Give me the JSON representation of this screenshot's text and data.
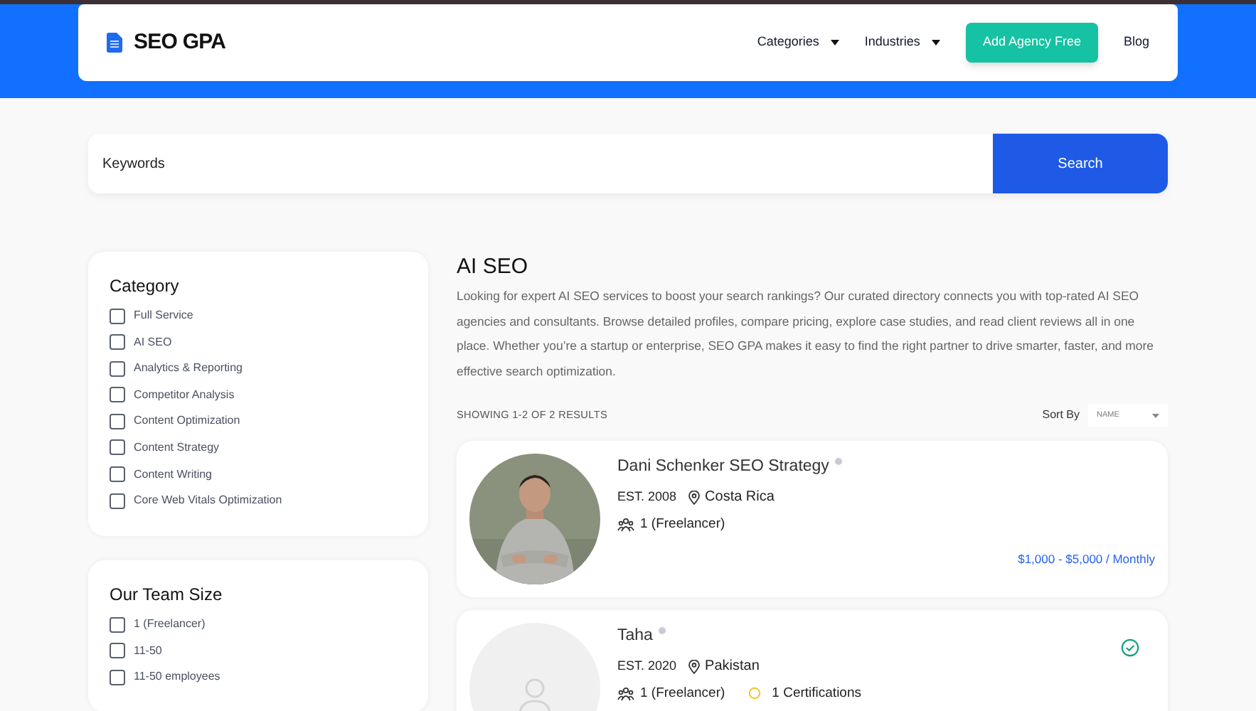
{
  "brand": {
    "name": "SEO GPA"
  },
  "nav": [
    {
      "kind": "dropdown",
      "label": "Categories"
    },
    {
      "kind": "dropdown",
      "label": "Industries"
    },
    {
      "kind": "cta",
      "label": "Add Agency Free"
    },
    {
      "kind": "link",
      "label": "Blog"
    }
  ],
  "search": {
    "placeholder": "Keywords",
    "button": "Search"
  },
  "filters": [
    {
      "title": "Category",
      "options": [
        {
          "label": "Full Service",
          "checked": false
        },
        {
          "label": "AI SEO",
          "checked": false
        },
        {
          "label": "Analytics & Reporting",
          "checked": false
        },
        {
          "label": "Competitor Analysis",
          "checked": false
        },
        {
          "label": "Content Optimization",
          "checked": false
        },
        {
          "label": "Content Strategy",
          "checked": false
        },
        {
          "label": "Content Writing",
          "checked": false
        },
        {
          "label": "Core Web Vitals Optimization",
          "checked": false
        }
      ]
    },
    {
      "title": "Our Team Size",
      "options": [
        {
          "label": "1 (Freelancer)",
          "checked": false
        },
        {
          "label": "11-50",
          "checked": false
        },
        {
          "label": "11-50 employees",
          "checked": false
        }
      ]
    }
  ],
  "page": {
    "title": "AI SEO",
    "description": "Looking for expert AI SEO services to boost your search rankings? Our curated directory connects you with top-rated AI SEO agencies and consultants. Browse detailed profiles, compare pricing, explore case studies, and read client reviews all in one place. Whether you’re a startup or enterprise, SEO GPA makes it easy to find the right partner to drive smarter, faster, and more effective search optimization.",
    "results": "SHOWING 1-2 OF 2 RESULTS",
    "sort_label": "Sort By",
    "sort_value": "NAME"
  },
  "agencies": [
    {
      "name": "Dani Schenker SEO Strategy",
      "has_photo": true,
      "est": "EST. 2008",
      "location": "Costa Rica",
      "team": "1 (Freelancer)",
      "price": "$1,000 - $5,000 / Monthly",
      "verified": false
    },
    {
      "name": "Taha",
      "has_photo": false,
      "est": "EST. 2020",
      "location": "Pakistan",
      "team": "1 (Freelancer)",
      "certifications": "1 Certifications",
      "verified": true
    }
  ]
}
